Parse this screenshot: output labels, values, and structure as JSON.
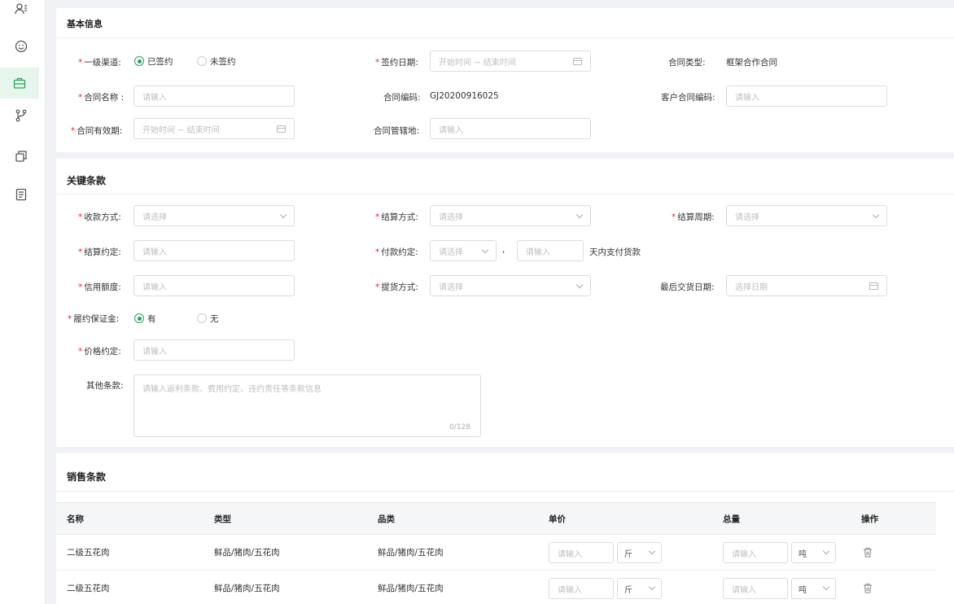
{
  "colors": {
    "accent": "#27a35a",
    "required": "#f5222d"
  },
  "sidebar": {
    "icons": [
      {
        "name": "users-icon"
      },
      {
        "name": "smile-icon"
      },
      {
        "name": "briefcase-icon",
        "active": true
      },
      {
        "name": "branch-icon"
      },
      {
        "name": "layers-icon"
      },
      {
        "name": "document-icon"
      }
    ]
  },
  "basic": {
    "title": "基本信息",
    "channel": {
      "label": "一级渠道:",
      "opt1": "已签约",
      "opt2": "未签约",
      "selected": "已签约"
    },
    "sign_date": {
      "label": "签约日期:",
      "placeholder": "开始时间 ~ 结束时间"
    },
    "contract_type": {
      "label": "合同类型:",
      "value": "框架合作合同"
    },
    "contract_name": {
      "label": "合同名称 :",
      "placeholder": "请输入"
    },
    "contract_code": {
      "label": "合同编码:",
      "value": "GJ20200916025"
    },
    "customer_code": {
      "label": "客户合同编码:",
      "placeholder": "请输入"
    },
    "validity": {
      "label": "合同有效期:",
      "placeholder": "开始时间 ~ 结束时间"
    },
    "jurisdiction": {
      "label": "合同管辖地:",
      "placeholder": "请输入"
    }
  },
  "terms": {
    "title": "关键条款",
    "collect": {
      "label": "收款方式:",
      "placeholder": "请选择"
    },
    "settle_method": {
      "label": "结算方式:",
      "placeholder": "请选择"
    },
    "settle_cycle": {
      "label": "结算周期:",
      "placeholder": "请选择"
    },
    "settle_agree": {
      "label": "结算约定:",
      "placeholder": "请输入"
    },
    "pay_agree": {
      "label": "付款约定:",
      "select_placeholder": "请选择",
      "comma": ",",
      "input_placeholder": "请输入",
      "suffix": "天内支付货款"
    },
    "credit": {
      "label": "信用额度:",
      "placeholder": "请输入"
    },
    "pickup": {
      "label": "提货方式:",
      "placeholder": "请选择"
    },
    "last_delivery": {
      "label": "最后交货日期:",
      "placeholder": "选择日期"
    },
    "deposit": {
      "label": "履约保证金:",
      "opt1": "有",
      "opt2": "无",
      "selected": "有"
    },
    "price": {
      "label": "价格约定:",
      "placeholder": "请输入"
    },
    "other": {
      "label": "其他条款:",
      "placeholder": "请输入返利条款、费用约定、违约责任等条款信息",
      "counter": "0/128"
    }
  },
  "sales": {
    "title": "销售条款",
    "columns": [
      "名称",
      "类型",
      "品类",
      "单价",
      "总量",
      "操作"
    ],
    "rows": [
      {
        "name": "二级五花肉",
        "type": "鲜品/猪肉/五花肉",
        "category": "鲜品/猪肉/五花肉",
        "price_placeholder": "请输入",
        "price_unit": "斤",
        "qty_placeholder": "请输入",
        "qty_unit": "吨"
      },
      {
        "name": "二级五花肉",
        "type": "鲜品/猪肉/五花肉",
        "category": "鲜品/猪肉/五花肉",
        "price_placeholder": "请输入",
        "price_unit": "斤",
        "qty_placeholder": "请输入",
        "qty_unit": "吨"
      }
    ]
  }
}
